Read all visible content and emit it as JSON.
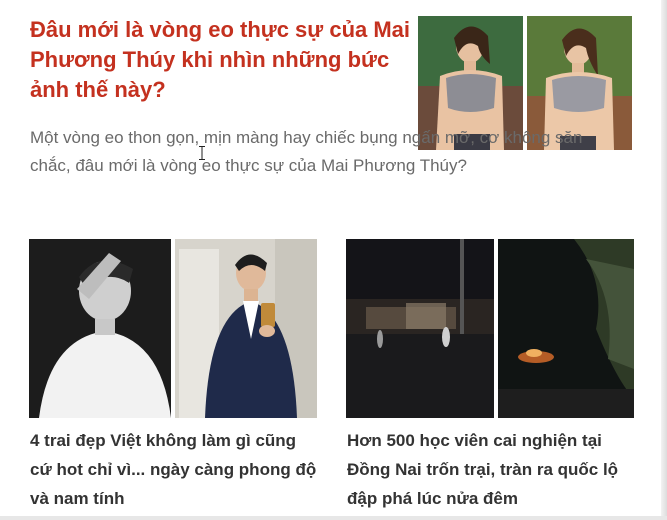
{
  "featured": {
    "title": "Đâu mới là vòng eo thực sự của Mai Phương Thúy khi nhìn những bức ảnh thế này?",
    "summary": "Một vòng eo thon gọn, mịn màng hay chiếc bụng ngấn mỡ, cơ không săn chắc, đâu mới là vòng eo thực sự của Mai Phương Thúy?",
    "accent_color": "#c4311f"
  },
  "cards": [
    {
      "title": "4 trai đẹp Việt không làm gì cũng cứ hot chỉ vì... ngày càng phong độ và nam tính"
    },
    {
      "title": "Hơn 500 học viên cai nghiện tại Đồng Nai trốn trại, tràn ra quốc lộ đập phá lúc nửa đêm"
    }
  ],
  "colors": {
    "title_text": "#333333",
    "summary_text": "#6a6a6a"
  }
}
